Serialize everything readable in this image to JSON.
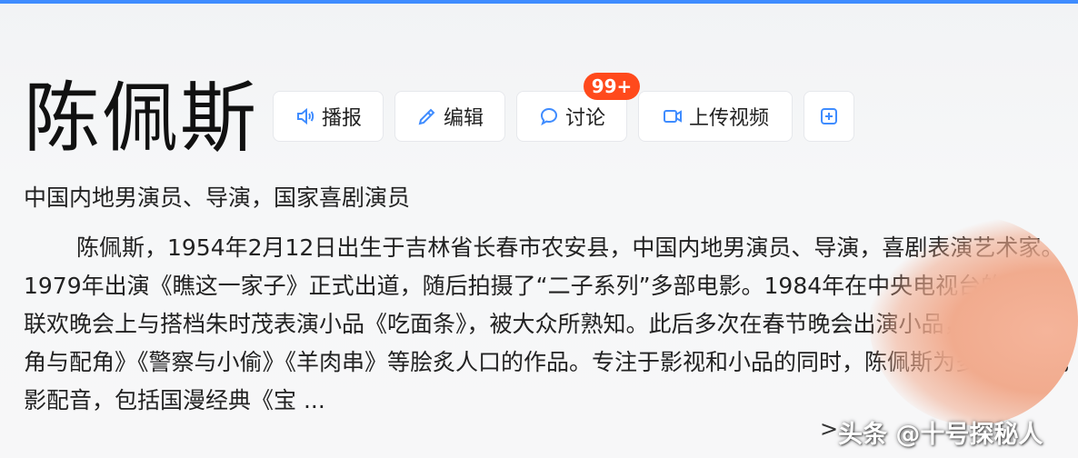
{
  "page": {
    "title": "陈佩斯",
    "subtitle": "中国内地男演员、导演，国家喜剧演员",
    "summary": "陈佩斯，1954年2月12日出生于吉林省长春市农安县，中国内地男演员、导演，喜剧表演艺术家。1979年出演《瞧这一家子》正式出道，随后拍摄了“二子系列”多部电影。1984年在中央电视台的春节联欢晚会上与搭档朱时茂表演小品《吃面条》，被大众所熟知。此后多次在春节晚会出演小品，包括《主角与配角》《警察与小偷》《羊肉串》等脍炙人口的作品。专注于影视和小品的同时，陈佩斯为多部动画电影配音，包括国漫经典《宝 ...",
    "more_arrow": ">",
    "accent_color": "#3f8cff"
  },
  "toolbar": {
    "broadcast_label": "播报",
    "edit_label": "编辑",
    "discuss_label": "讨论",
    "discuss_badge": "99+",
    "upload_label": "上传视频",
    "add_icon": "plus-square-icon",
    "badge_color": "#ff4a1c"
  },
  "watermark": {
    "text": "头条 @十号探秘人"
  }
}
